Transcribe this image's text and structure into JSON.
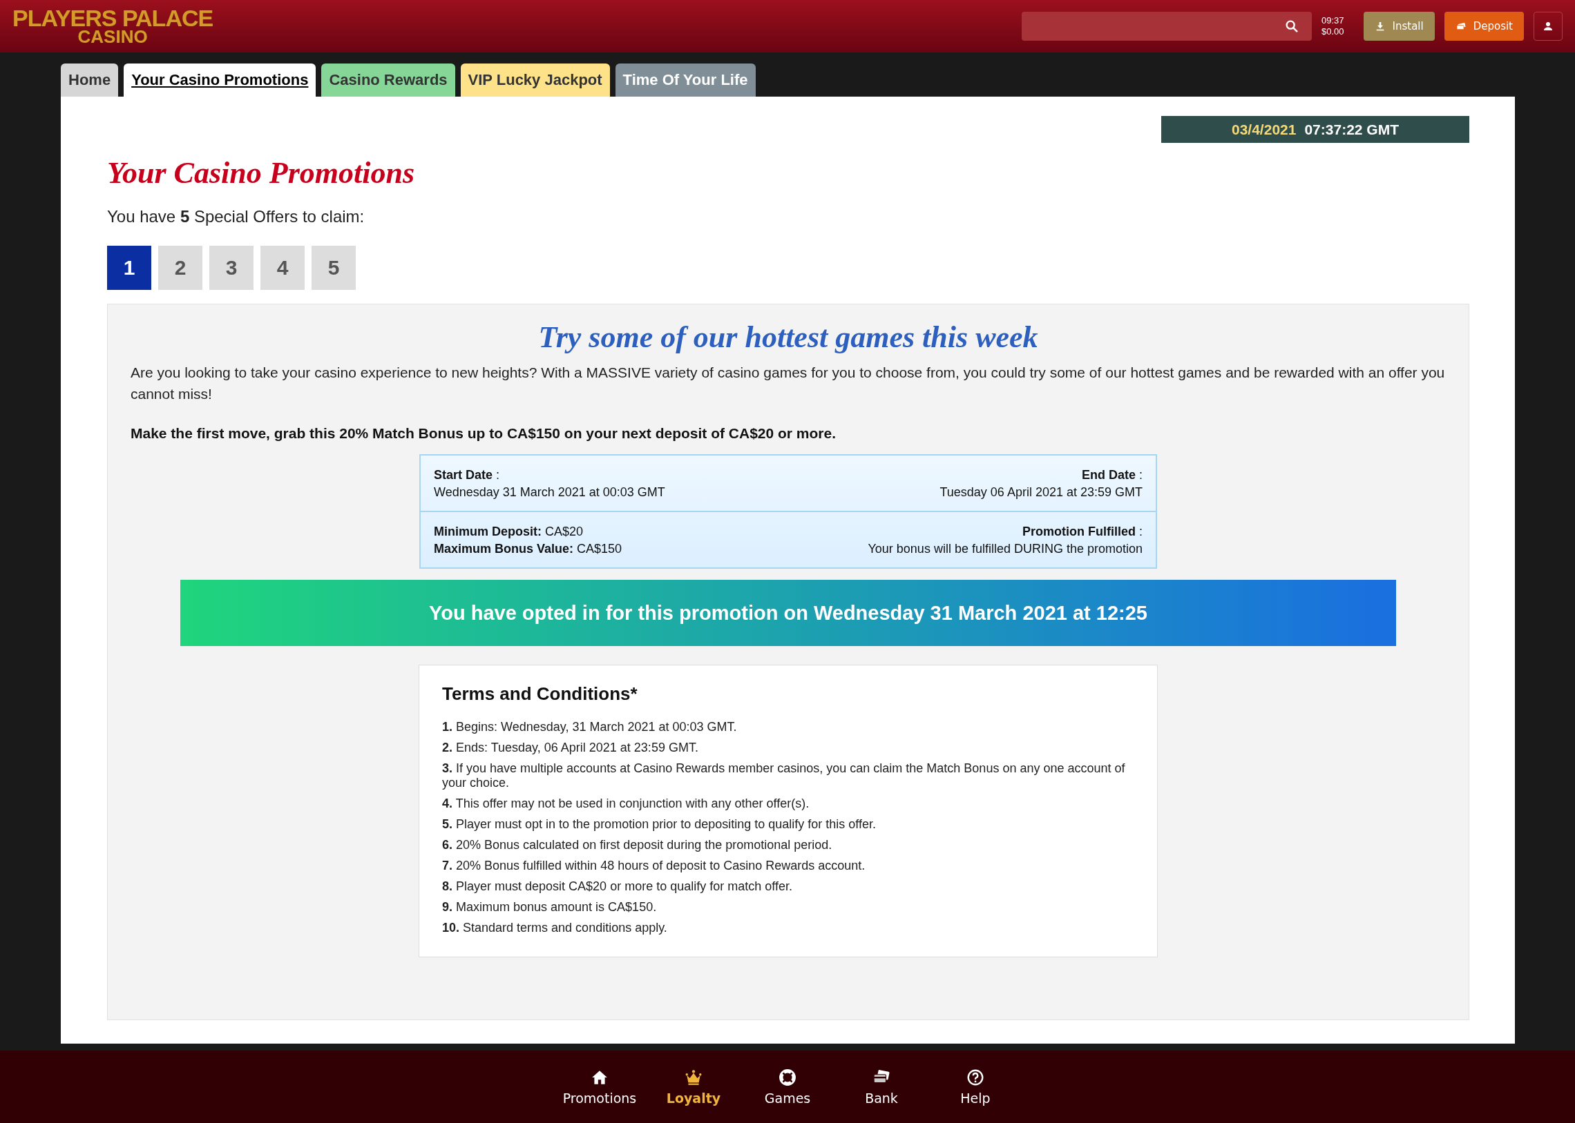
{
  "header": {
    "logo": {
      "line_1": "PLAYERS PALACE",
      "line_2": "CASINO"
    },
    "clock": "09:37",
    "balance": "$0.00",
    "install_button": "Install",
    "deposit_button": "Deposit"
  },
  "tabs": [
    {
      "label": "Home",
      "selected": false,
      "color": "#d6d6d6"
    },
    {
      "label": "Your Casino Promotions",
      "selected": true,
      "color": "#ffffff"
    },
    {
      "label": "Casino Rewards",
      "selected": false,
      "color": "#86d797"
    },
    {
      "label": "VIP Lucky Jackpot",
      "selected": false,
      "color": "#fde28a"
    },
    {
      "label": "Time Of Your Life",
      "selected": false,
      "color": "#7f8e97"
    }
  ],
  "datetime": {
    "date": "03/4/2021",
    "time": "07:37:22 GMT"
  },
  "page_title": "Your Casino Promotions",
  "intro": "You have **5** Special Offers to claim:",
  "pager": [
    {
      "label": "1",
      "selected": true
    },
    {
      "label": "2",
      "selected": false
    },
    {
      "label": "3",
      "selected": false
    },
    {
      "label": "4",
      "selected": false
    },
    {
      "label": "5",
      "selected": false
    }
  ],
  "offer": {
    "headline": "Try some of our hottest games this week",
    "description": "Are you looking to take your casino experience to new heights? With a MASSIVE variety of casino games for you to choose from, you could try some of our hottest games and be rewarded with an offer you cannot miss!",
    "call_to_action": "Make the first move, grab this 20% Match Bonus up to CA$150 on your next deposit of CA$20 or more.",
    "details": [
      {
        "left_label": "**Start Date** :",
        "left_value": "Wednesday 31 March 2021 at 00:03 GMT",
        "right_label": "**End Date** :",
        "right_value": "Tuesday 06 April 2021 at 23:59 GMT"
      },
      {
        "left_label": "**Minimum Deposit:** CA$20",
        "left_value": "**Maximum Bonus Value:** CA$150",
        "right_label": "**Promotion Fulfilled** :",
        "right_value": "Your bonus will be fulfilled DURING the promotion"
      }
    ],
    "opt_in_banner": "You have opted in for this promotion on Wednesday 31 March 2021 at 12:25",
    "terms_title": "Terms and Conditions*",
    "terms": [
      "**1.** Begins: Wednesday, 31 March 2021 at 00:03 GMT.",
      "**2.** Ends: Tuesday, 06 April 2021 at 23:59 GMT.",
      "**3.** If you have multiple accounts at Casino Rewards member casinos, you can claim the Match Bonus on any one account of your choice.",
      "**4.** This offer may not be used in conjunction with any other offer(s).",
      "**5.** Player must opt in to the promotion prior to depositing to qualify for this offer.",
      "**6.** 20% Bonus calculated on first deposit during the promotional period.",
      "**7.** 20% Bonus fulfilled within 48 hours of deposit to Casino Rewards account.",
      "**8.** Player must deposit CA$20 or more to qualify for match offer.",
      "**9.** Maximum bonus amount is CA$150.",
      "**10.** Standard terms and conditions apply."
    ]
  },
  "bottom_nav": [
    {
      "label": "Promotions",
      "selected": false
    },
    {
      "label": "Loyalty",
      "selected": true
    },
    {
      "label": "Games",
      "selected": false
    },
    {
      "label": "Bank",
      "selected": false
    },
    {
      "label": "Help",
      "selected": false
    }
  ]
}
